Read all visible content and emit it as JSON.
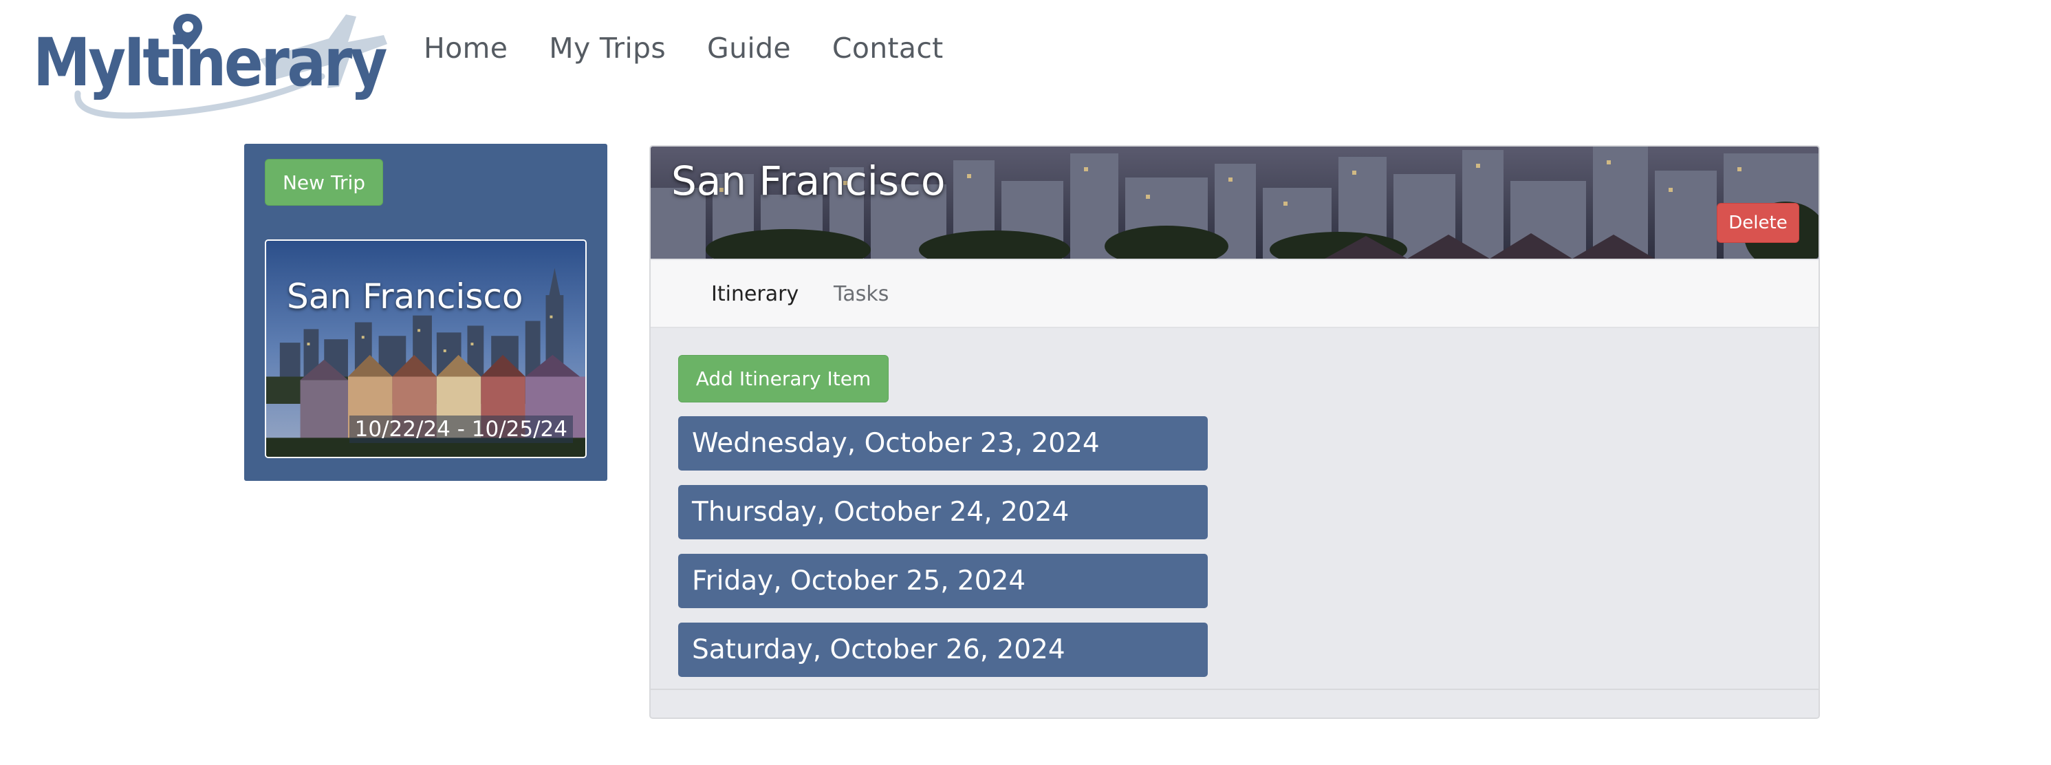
{
  "app": {
    "logo_text": "MyItinerary"
  },
  "nav": {
    "items": [
      {
        "label": "Home"
      },
      {
        "label": "My Trips"
      },
      {
        "label": "Guide"
      },
      {
        "label": "Contact"
      }
    ]
  },
  "sidebar": {
    "new_trip_label": "New Trip",
    "trips": [
      {
        "title": "San Francisco",
        "dates": "10/22/24 - 10/25/24"
      }
    ]
  },
  "trip": {
    "title": "San Francisco",
    "delete_label": "Delete",
    "tabs": [
      {
        "label": "Itinerary",
        "active": true
      },
      {
        "label": "Tasks",
        "active": false
      }
    ],
    "add_item_label": "Add Itinerary Item",
    "days": [
      {
        "label": "Wednesday, October 23, 2024"
      },
      {
        "label": "Thursday, October 24, 2024"
      },
      {
        "label": "Friday, October 25, 2024"
      },
      {
        "label": "Saturday, October 26, 2024"
      }
    ]
  },
  "colors": {
    "brand_blue": "#43618d",
    "day_item": "#4f6a93",
    "success_green": "#6bb366",
    "danger_red": "#d9534f",
    "panel_bg": "#e8e9ed"
  },
  "icons": [
    "map-pin-icon",
    "airplane-icon"
  ]
}
